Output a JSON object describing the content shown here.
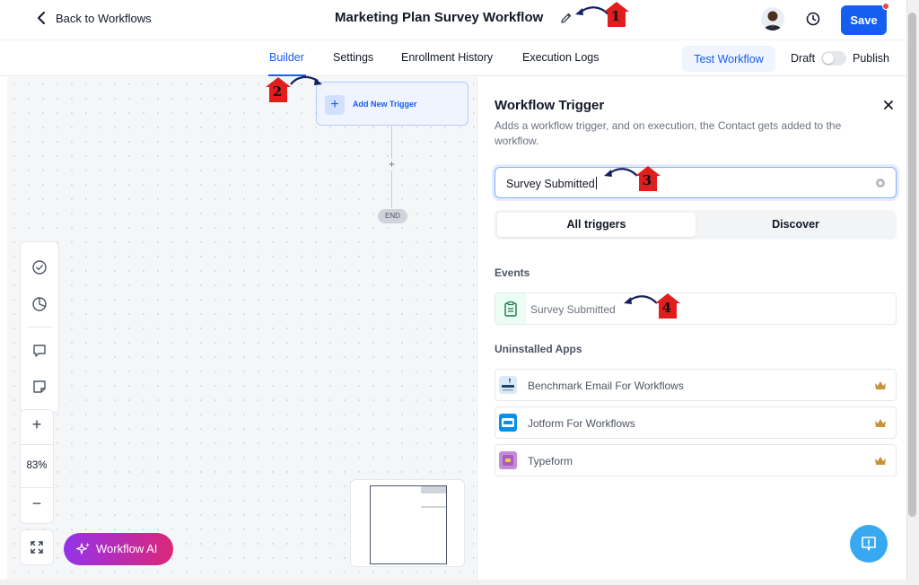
{
  "header": {
    "back_label": "Back to Workflows",
    "title": "Marketing Plan Survey Workflow",
    "save_label": "Save"
  },
  "tabs": [
    {
      "label": "Builder",
      "active": true
    },
    {
      "label": "Settings",
      "active": false
    },
    {
      "label": "Enrollment History",
      "active": false
    },
    {
      "label": "Execution Logs",
      "active": false
    }
  ],
  "actions": {
    "test_label": "Test Workflow",
    "draft_label": "Draft",
    "publish_label": "Publish",
    "published": false
  },
  "canvas": {
    "trigger_label": "Add New Trigger",
    "end_label": "END",
    "zoom_level": "83%",
    "ai_label": "Workflow AI"
  },
  "panel": {
    "title": "Workflow Trigger",
    "description": "Adds a workflow trigger, and on execution, the Contact gets added to the workflow.",
    "search_value": "Survey Submitted",
    "segments": [
      "All triggers",
      "Discover"
    ],
    "events_heading": "Events",
    "events": [
      {
        "label": "Survey Submitted",
        "icon": "clipboard-icon"
      }
    ],
    "apps_heading": "Uninstalled Apps",
    "apps": [
      {
        "label": "Benchmark Email For Workflows",
        "logo_color": "#dbe9f7"
      },
      {
        "label": "Jotform For Workflows",
        "logo_color": "#0a8fe6"
      },
      {
        "label": "Typeform",
        "logo_color": "#c58ad8"
      }
    ]
  },
  "annotations": [
    "1",
    "2",
    "3",
    "4"
  ],
  "colors": {
    "primary": "#155eef",
    "annotation_red": "#e01e1e",
    "annotation_arrow": "#16205f",
    "crown": "#c9913b"
  }
}
